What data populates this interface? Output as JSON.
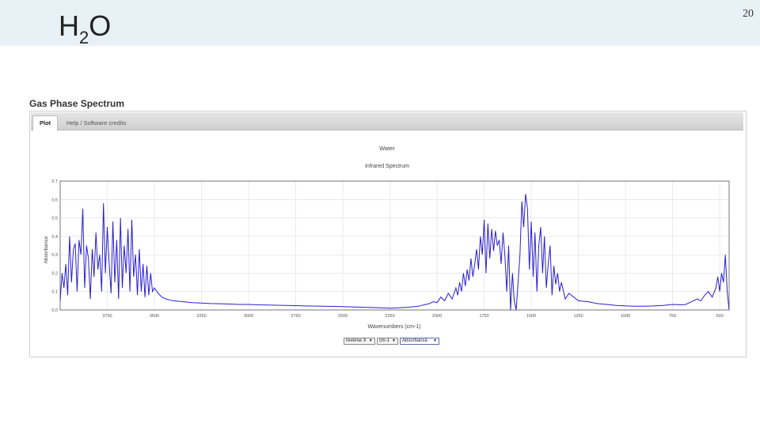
{
  "slide": {
    "title_main": "H",
    "title_sub": "2",
    "title_end": "O",
    "page_number": "20"
  },
  "section": {
    "heading": "Gas Phase Spectrum"
  },
  "tabs": [
    {
      "label": "Plot",
      "active": true
    },
    {
      "label": "Help / Software credits",
      "active": false
    }
  ],
  "controls": {
    "x_direction": "reverse X",
    "x_units": "cm-1",
    "y_units": "Absorbance"
  },
  "colors": {
    "trace": "#2a1fd0",
    "grid": "#dedede",
    "header_bg": "#e8f2f6"
  },
  "chart_data": {
    "type": "line",
    "title": "Water",
    "subtitle": "Infrared Spectrum",
    "xlabel": "Wavenumbers (cm-1)",
    "ylabel": "Absorbance",
    "xlim": [
      4000,
      450
    ],
    "x_reversed": true,
    "ylim": [
      0,
      0.7
    ],
    "xticks": [
      3750,
      3500,
      3250,
      3000,
      2750,
      2500,
      2250,
      2000,
      1750,
      1500,
      1250,
      1000,
      750,
      500
    ],
    "yticks": [
      0.0,
      0.1,
      0.2,
      0.3,
      0.4,
      0.5,
      0.6,
      0.7
    ],
    "grid": true,
    "series": [
      {
        "x": [
          4000,
          3990,
          3980,
          3970,
          3960,
          3950,
          3940,
          3930,
          3920,
          3910,
          3900,
          3890,
          3880,
          3870,
          3860,
          3850,
          3840,
          3830,
          3820,
          3810,
          3800,
          3790,
          3780,
          3770,
          3760,
          3750,
          3740,
          3730,
          3720,
          3710,
          3700,
          3690,
          3680,
          3670,
          3660,
          3650,
          3640,
          3630,
          3620,
          3610,
          3600,
          3590,
          3580,
          3570,
          3560,
          3550,
          3540,
          3530,
          3520,
          3510,
          3500,
          3480,
          3460,
          3440,
          3420,
          3400,
          3350,
          3300,
          3250,
          3200,
          3150,
          3100,
          3050,
          3000,
          2950,
          2900,
          2800,
          2700,
          2600,
          2500,
          2400,
          2300,
          2250,
          2200,
          2150,
          2100,
          2080,
          2060,
          2040,
          2020,
          2000,
          1980,
          1960,
          1940,
          1920,
          1900,
          1890,
          1880,
          1870,
          1860,
          1850,
          1840,
          1830,
          1820,
          1810,
          1800,
          1790,
          1780,
          1770,
          1760,
          1750,
          1740,
          1730,
          1720,
          1710,
          1700,
          1690,
          1680,
          1670,
          1660,
          1650,
          1640,
          1630,
          1620,
          1610,
          1600,
          1590,
          1580,
          1570,
          1560,
          1550,
          1540,
          1530,
          1520,
          1510,
          1500,
          1490,
          1480,
          1470,
          1460,
          1450,
          1440,
          1430,
          1420,
          1410,
          1400,
          1390,
          1380,
          1370,
          1360,
          1350,
          1340,
          1320,
          1300,
          1250,
          1200,
          1150,
          1100,
          1050,
          1000,
          950,
          900,
          850,
          800,
          750,
          700,
          680,
          660,
          640,
          620,
          600,
          580,
          560,
          540,
          520,
          510,
          500,
          490,
          480,
          470,
          460,
          450
        ],
        "y": [
          0.05,
          0.2,
          0.12,
          0.25,
          0.08,
          0.4,
          0.15,
          0.33,
          0.36,
          0.1,
          0.38,
          0.3,
          0.55,
          0.12,
          0.35,
          0.28,
          0.06,
          0.33,
          0.18,
          0.42,
          0.22,
          0.3,
          0.1,
          0.58,
          0.2,
          0.45,
          0.25,
          0.09,
          0.48,
          0.15,
          0.38,
          0.06,
          0.5,
          0.12,
          0.35,
          0.2,
          0.44,
          0.1,
          0.49,
          0.18,
          0.3,
          0.08,
          0.33,
          0.1,
          0.25,
          0.07,
          0.24,
          0.08,
          0.2,
          0.1,
          0.12,
          0.09,
          0.07,
          0.06,
          0.055,
          0.05,
          0.045,
          0.04,
          0.038,
          0.035,
          0.034,
          0.032,
          0.03,
          0.03,
          0.028,
          0.027,
          0.025,
          0.022,
          0.02,
          0.018,
          0.015,
          0.012,
          0.01,
          0.012,
          0.015,
          0.02,
          0.025,
          0.03,
          0.035,
          0.045,
          0.04,
          0.07,
          0.05,
          0.09,
          0.06,
          0.12,
          0.08,
          0.15,
          0.1,
          0.2,
          0.13,
          0.22,
          0.16,
          0.28,
          0.18,
          0.25,
          0.33,
          0.22,
          0.4,
          0.3,
          0.49,
          0.2,
          0.47,
          0.28,
          0.44,
          0.32,
          0.43,
          0.35,
          0.38,
          0.25,
          0.42,
          0.3,
          0.1,
          0.35,
          0.0,
          0.2,
          0.05,
          0.0,
          0.15,
          0.3,
          0.59,
          0.45,
          0.63,
          0.55,
          0.22,
          0.48,
          0.18,
          0.42,
          0.1,
          0.35,
          0.45,
          0.2,
          0.4,
          0.12,
          0.25,
          0.35,
          0.08,
          0.24,
          0.14,
          0.2,
          0.1,
          0.15,
          0.06,
          0.09,
          0.05,
          0.045,
          0.035,
          0.03,
          0.025,
          0.022,
          0.02,
          0.02,
          0.022,
          0.025,
          0.03,
          0.028,
          0.03,
          0.04,
          0.05,
          0.06,
          0.05,
          0.08,
          0.1,
          0.07,
          0.12,
          0.18,
          0.1,
          0.2,
          0.15,
          0.3,
          0.1,
          0.0
        ]
      }
    ]
  }
}
